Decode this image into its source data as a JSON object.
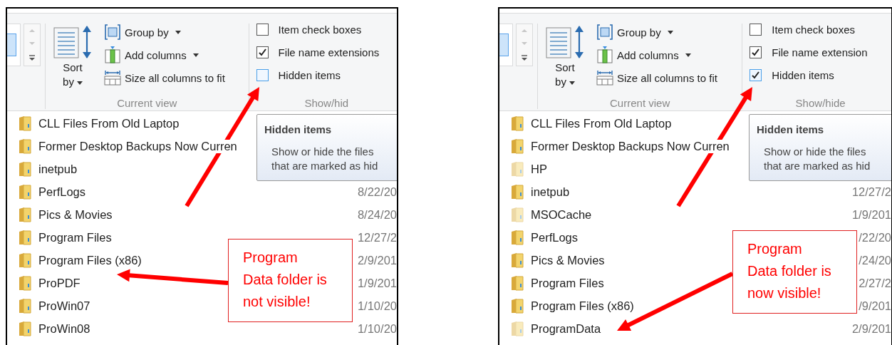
{
  "panels": [
    {
      "ribbon": {
        "sort_label": "Sort\nby",
        "view_commands": [
          {
            "kind": "group",
            "label": "Group by"
          },
          {
            "kind": "columns",
            "label": "Add columns"
          },
          {
            "kind": "fit",
            "label": "Size all columns to fit"
          }
        ],
        "current_view": "Current view",
        "show_hide": "Show/hid",
        "checkboxes": [
          {
            "label": "Item check boxes",
            "checked": false,
            "highlighted": false
          },
          {
            "label": "File name extensions",
            "checked": true,
            "highlighted": false
          },
          {
            "label": "Hidden items",
            "checked": false,
            "highlighted": true
          }
        ]
      },
      "files": [
        {
          "name": "CLL Files From Old Laptop",
          "hidden": false
        },
        {
          "name": "Former Desktop Backups Now Curren",
          "hidden": false
        },
        {
          "name": "inetpub",
          "hidden": false
        },
        {
          "name": "PerfLogs",
          "date": "8/22/20",
          "hidden": false
        },
        {
          "name": "Pics & Movies",
          "date": "8/24/20",
          "hidden": false
        },
        {
          "name": "Program Files",
          "date": "12/27/2",
          "hidden": false
        },
        {
          "name": "Program Files (x86)",
          "date": "2/9/201",
          "hidden": false
        },
        {
          "name": "ProPDF",
          "date": "1/9/201",
          "hidden": false
        },
        {
          "name": "ProWin07",
          "date": "1/10/20",
          "hidden": false
        },
        {
          "name": "ProWin08",
          "date": "1/10/20",
          "hidden": false
        }
      ],
      "tooltip": {
        "title": "Hidden items",
        "text": "Show or hide the files\nthat are marked as hid"
      },
      "callout": "Program\nData folder is\nnot visible!"
    },
    {
      "ribbon": {
        "sort_label": "Sort\nby",
        "view_commands": [
          {
            "kind": "group",
            "label": "Group by"
          },
          {
            "kind": "columns",
            "label": "Add columns"
          },
          {
            "kind": "fit",
            "label": "Size all columns to fit"
          }
        ],
        "current_view": "Current view",
        "show_hide": "Show/hide",
        "checkboxes": [
          {
            "label": "Item check boxes",
            "checked": false,
            "highlighted": false
          },
          {
            "label": "File name extension",
            "checked": true,
            "highlighted": false
          },
          {
            "label": "Hidden items",
            "checked": true,
            "highlighted": true
          }
        ]
      },
      "files": [
        {
          "name": "CLL Files From Old Laptop",
          "hidden": false
        },
        {
          "name": "Former Desktop Backups Now Curren",
          "hidden": false
        },
        {
          "name": "HP",
          "hidden": true
        },
        {
          "name": "inetpub",
          "date": "12/27/2",
          "hidden": false
        },
        {
          "name": "MSOCache",
          "date": "1/9/201",
          "hidden": true
        },
        {
          "name": "PerfLogs",
          "date": "/22/20",
          "hidden": false
        },
        {
          "name": "Pics & Movies",
          "date": "/24/20",
          "hidden": false
        },
        {
          "name": "Program Files",
          "date": "2/27/2",
          "hidden": false
        },
        {
          "name": "Program Files (x86)",
          "date": "/9/201",
          "hidden": false
        },
        {
          "name": "ProgramData",
          "date": "2/9/201",
          "hidden": true
        }
      ],
      "tooltip": {
        "title": "Hidden items",
        "text": "Show or hide the files\nthat are marked as hid"
      },
      "callout": "Program\nData folder is\nnow visible!"
    }
  ]
}
